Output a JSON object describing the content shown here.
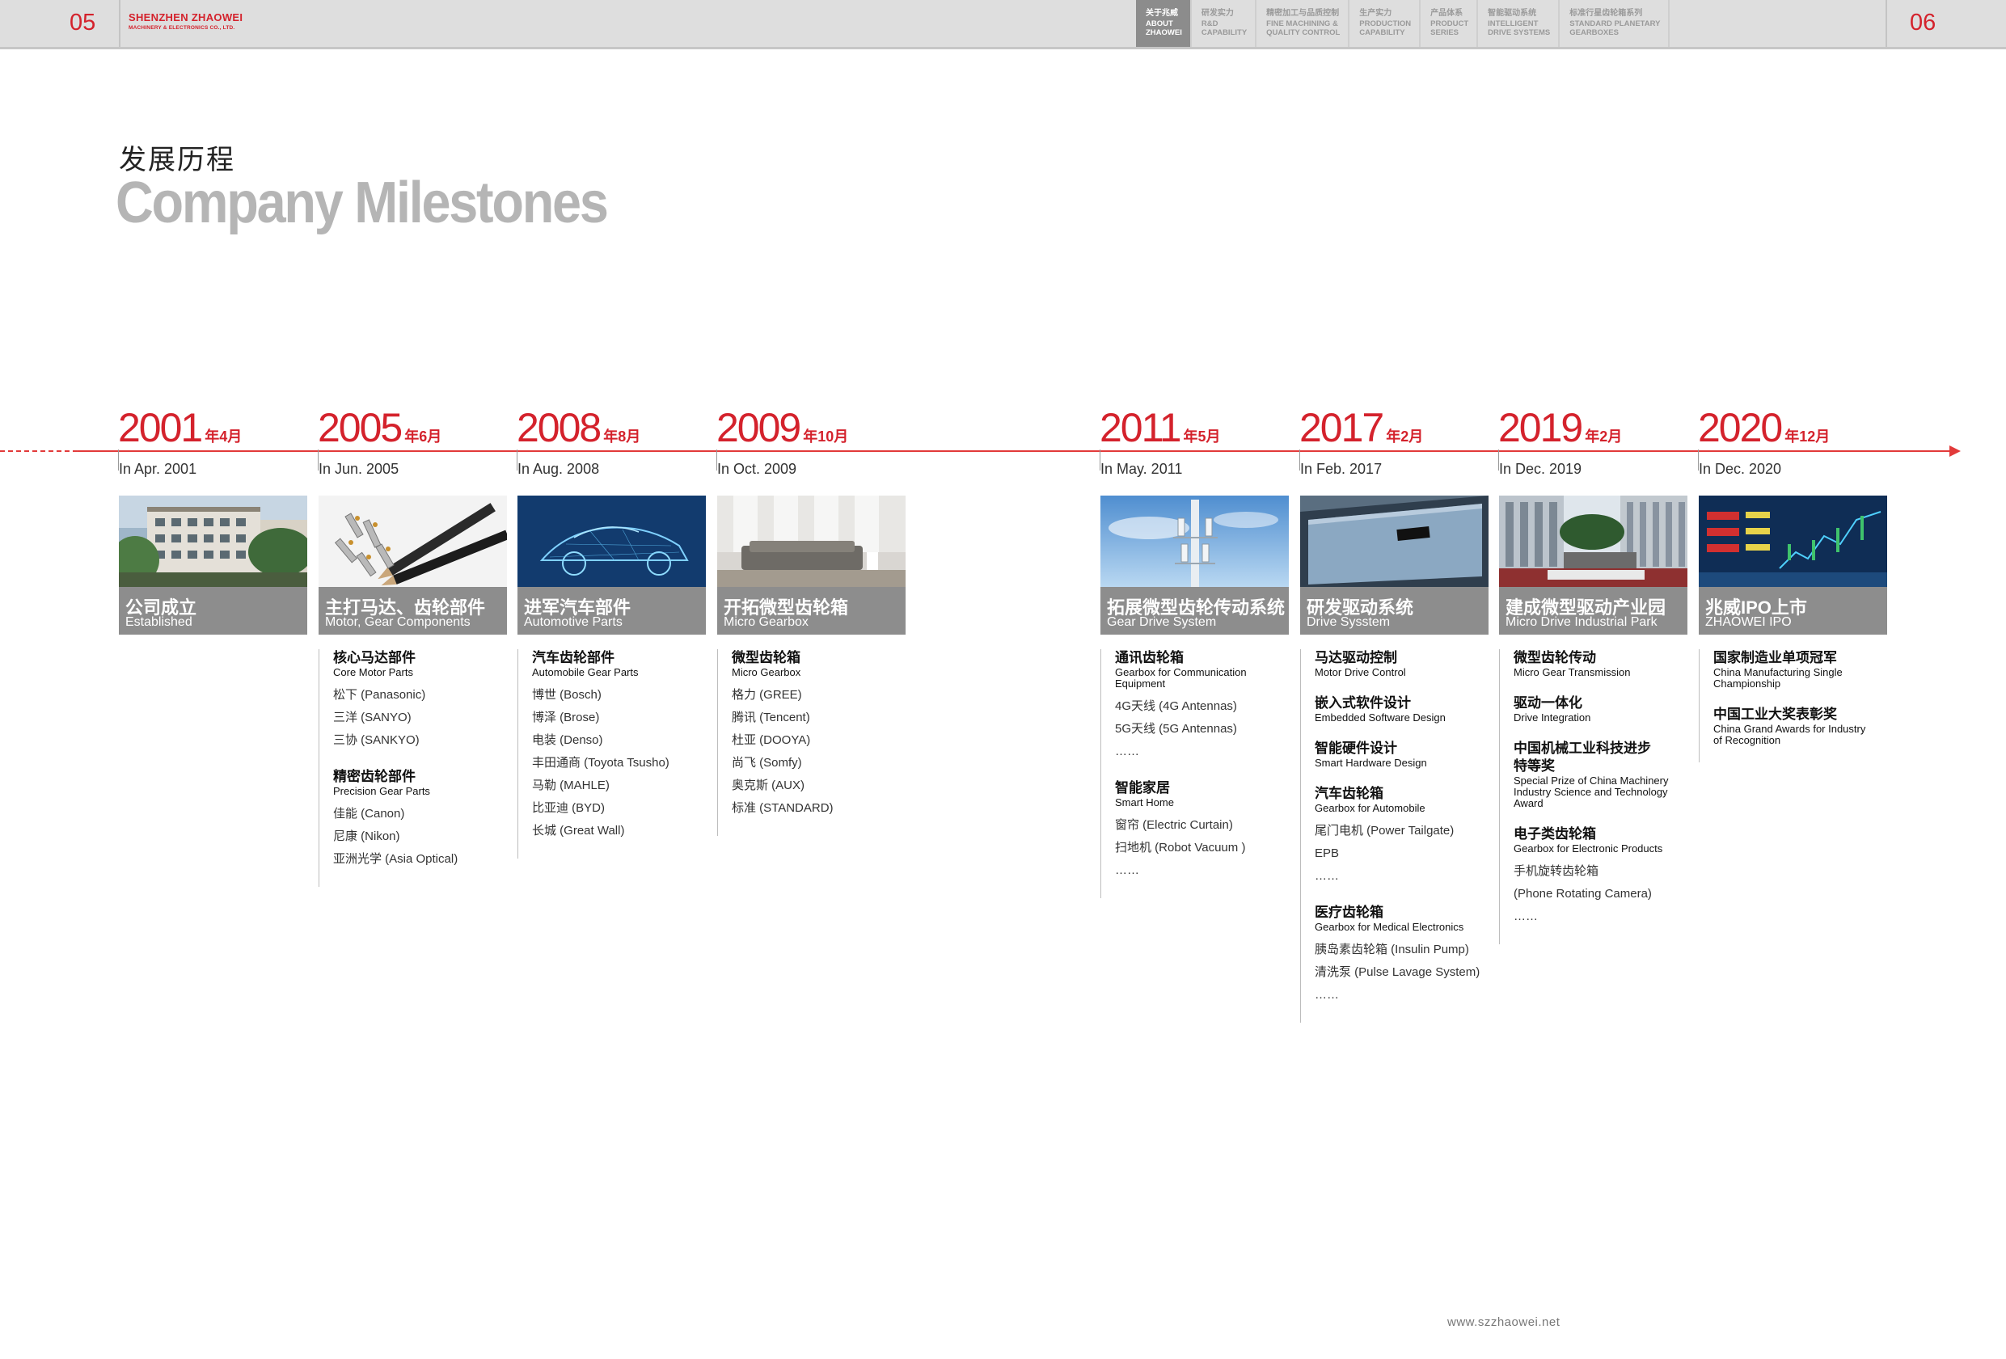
{
  "header": {
    "page_left": "05",
    "page_right": "06",
    "brand_name": "SHENZHEN ZHAOWEI",
    "brand_sub": "MACHINERY & ELECTRONICS CO., LTD.",
    "nav": [
      {
        "cn": "关于兆威",
        "en": "ABOUT\nZHAOWEI",
        "active": true
      },
      {
        "cn": "研发实力",
        "en": "R&D\nCAPABILITY",
        "active": false
      },
      {
        "cn": "精密加工与品质控制",
        "en": "FINE MACHINING &\nQUALITY CONTROL",
        "active": false
      },
      {
        "cn": "生产实力",
        "en": "PRODUCTION\nCAPABILITY",
        "active": false
      },
      {
        "cn": "产品体系",
        "en": "PRODUCT\nSERIES",
        "active": false
      },
      {
        "cn": "智能驱动系统",
        "en": "INTELLIGENT\nDRIVE SYSTEMS",
        "active": false
      },
      {
        "cn": "标准行星齿轮箱系列",
        "en": "STANDARD PLANETARY\nGEARBOXES",
        "active": false
      }
    ]
  },
  "title": {
    "cn": "发展历程",
    "en": "Company Milestones"
  },
  "colors": {
    "accent": "#d4222c",
    "card_bg": "#8d8d8d",
    "title_gray": "#b5b5b5"
  },
  "milestones": [
    {
      "year": "2001",
      "month": "年4月",
      "date": "In Apr. 2001",
      "card_cn": "公司成立",
      "card_en": "Established",
      "image": "office-building-image",
      "groups": []
    },
    {
      "year": "2005",
      "month": "年6月",
      "date": "In Jun. 2005",
      "card_cn": "主打马达、齿轮部件",
      "card_en": "Motor, Gear Components",
      "image": "gear-parts-image",
      "groups": [
        {
          "cn": "核心马达部件",
          "en": "Core Motor Parts",
          "items": [
            "松下 (Panasonic)",
            "三洋 (SANYO)",
            "三协 (SANKYO)"
          ]
        },
        {
          "cn": "精密齿轮部件",
          "en": "Precision Gear Parts",
          "items": [
            "佳能 (Canon)",
            "尼康 (Nikon)",
            "亚洲光学 (Asia Optical)"
          ]
        }
      ]
    },
    {
      "year": "2008",
      "month": "年8月",
      "date": "In Aug. 2008",
      "card_cn": "进军汽车部件",
      "card_en": "Automotive Parts",
      "image": "car-wireframe-image",
      "groups": [
        {
          "cn": "汽车齿轮部件",
          "en": "Automobile Gear Parts",
          "items": [
            "博世 (Bosch)",
            "博泽 (Brose)",
            "电装 (Denso)",
            "丰田通商 (Toyota Tsusho)",
            "马勒 (MAHLE)",
            "比亚迪 (BYD)",
            "长城 (Great Wall)"
          ]
        }
      ]
    },
    {
      "year": "2009",
      "month": "年10月",
      "date": "In Oct. 2009",
      "card_cn": "开拓微型齿轮箱",
      "card_en": "Micro Gearbox",
      "image": "living-room-image",
      "groups": [
        {
          "cn": "微型齿轮箱",
          "en": "Micro Gearbox",
          "items": [
            "格力 (GREE)",
            "腾讯 (Tencent)",
            "杜亚 (DOOYA)",
            "尚飞 (Somfy)",
            "奥克斯 (AUX)",
            "标准 (STANDARD)"
          ]
        }
      ]
    },
    {
      "year": "2011",
      "month": "年5月",
      "date": "In May. 2011",
      "card_cn": "拓展微型齿轮传动系统",
      "card_en": "Gear Drive System",
      "image": "signal-tower-image",
      "groups": [
        {
          "cn": "通讯齿轮箱",
          "en": "Gearbox for Communication\nEquipment",
          "items": [
            "4G天线 (4G Antennas)",
            "5G天线 (5G Antennas)",
            "……"
          ]
        },
        {
          "cn": "智能家居",
          "en": "Smart Home",
          "items": [
            "窗帘 (Electric Curtain)",
            "扫地机 (Robot Vacuum )",
            "……"
          ]
        }
      ]
    },
    {
      "year": "2017",
      "month": "年2月",
      "date": "In Feb. 2017",
      "card_cn": "研发驱动系统",
      "card_en": "Drive Sysstem",
      "image": "device-image",
      "groups": [
        {
          "cn": "马达驱动控制",
          "en": "Motor Drive Control",
          "items": []
        },
        {
          "cn": "嵌入式软件设计",
          "en": "Embedded Software Design",
          "items": []
        },
        {
          "cn": "智能硬件设计",
          "en": "Smart Hardware Design",
          "items": []
        },
        {
          "cn": "汽车齿轮箱",
          "en": "Gearbox for Automobile",
          "items": [
            "尾门电机 (Power Tailgate)",
            "EPB",
            "……"
          ]
        },
        {
          "cn": "医疗齿轮箱",
          "en": "Gearbox for Medical Electronics",
          "items": [
            "胰岛素齿轮箱 (Insulin Pump)",
            "清洗泵 (Pulse Lavage System)",
            "……"
          ]
        }
      ]
    },
    {
      "year": "2019",
      "month": "年2月",
      "date": "In Dec. 2019",
      "card_cn": "建成微型驱动产业园",
      "card_en": "Micro Drive Industrial Park",
      "image": "industrial-park-image",
      "groups": [
        {
          "cn": "微型齿轮传动",
          "en": "Micro Gear Transmission",
          "items": []
        },
        {
          "cn": "驱动一体化",
          "en": "Drive Integration",
          "items": []
        },
        {
          "cn": "中国机械工业科技进步\n特等奖",
          "en": "Special Prize of China Machinery\nIndustry Science and Technology\nAward",
          "items": []
        },
        {
          "cn": "电子类齿轮箱",
          "en": "Gearbox for Electronic Products",
          "items": [
            "手机旋转齿轮箱",
            "(Phone Rotating Camera)",
            "……"
          ]
        }
      ]
    },
    {
      "year": "2020",
      "month": "年12月",
      "date": "In Dec. 2020",
      "card_cn": "兆威IPO上市",
      "card_en": "ZHAOWEI IPO",
      "image": "stock-chart-image",
      "groups": [
        {
          "cn": "国家制造业单项冠军",
          "en": "China Manufacturing Single\nChampionship",
          "items": []
        },
        {
          "cn": "中国工业大奖表彰奖",
          "en": "China Grand Awards for Industry\nof Recognition",
          "items": []
        }
      ]
    }
  ],
  "footer": {
    "url": "www.szzhaowei.net"
  }
}
